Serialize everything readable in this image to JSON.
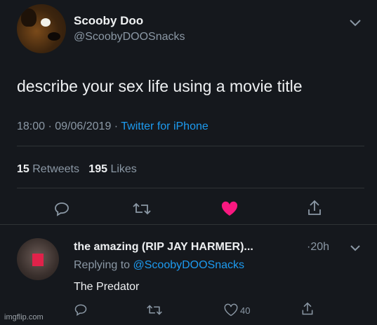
{
  "tweet": {
    "author_name": "Scooby Doo",
    "author_handle": "@ScoobyDOOSnacks",
    "text": "describe your sex life using a movie title",
    "timestamp": "18:00 · 09/06/2019 · ",
    "source": "Twitter for iPhone",
    "retweets_count": "15",
    "retweets_label": "Retweets",
    "likes_count": "195",
    "likes_label": "Likes",
    "icons": [
      "reply-icon",
      "retweet-icon",
      "heart-filled-icon",
      "share-icon"
    ],
    "heart_color": "#f91880"
  },
  "reply": {
    "author_name": "the amazing (RIP JAY HARMER)...",
    "time": "·20h",
    "replying_prefix": "Replying to ",
    "replying_mention": "@ScoobyDOOSnacks",
    "text": "The Predator",
    "like_count": "40",
    "icons": [
      "reply-icon",
      "retweet-icon",
      "heart-outline-icon",
      "share-icon"
    ]
  },
  "watermark": "imgflip.com",
  "colors": {
    "background": "#15181d",
    "link": "#1d9bf0",
    "muted": "#8b98a5"
  }
}
